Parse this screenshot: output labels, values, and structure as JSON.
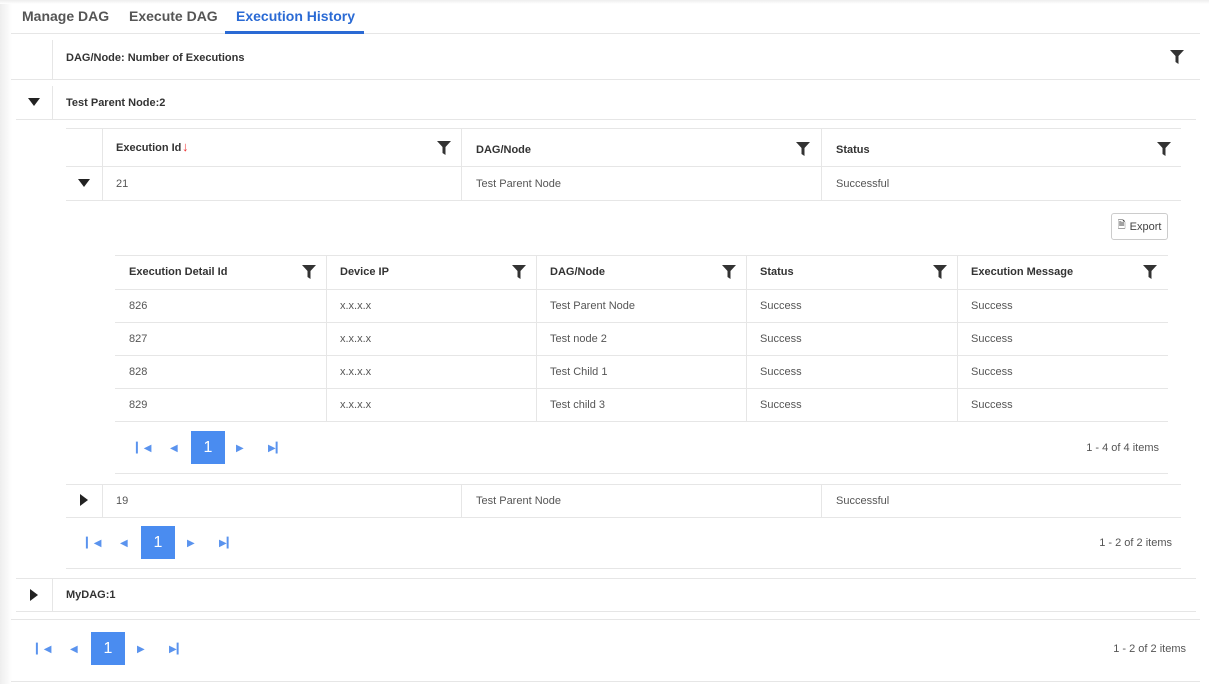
{
  "tabs": [
    {
      "label": "Manage DAG"
    },
    {
      "label": "Execute DAG"
    },
    {
      "label": "Execution History"
    }
  ],
  "outer": {
    "header": "DAG/Node: Number of Executions",
    "groups": [
      {
        "label": "Test Parent Node:2"
      },
      {
        "label": "MyDAG:1"
      }
    ],
    "pager": {
      "page": "1",
      "info": "1 - 2 of 2 items"
    }
  },
  "inner": {
    "columns": [
      "Execution Id",
      "DAG/Node",
      "Status"
    ],
    "rows": [
      {
        "id": "21",
        "node": "Test Parent Node",
        "status": "Successful"
      },
      {
        "id": "19",
        "node": "Test Parent Node",
        "status": "Successful"
      }
    ],
    "pager": {
      "page": "1",
      "info": "1 - 2 of 2 items"
    }
  },
  "detail": {
    "export_label": "Export",
    "columns": [
      "Execution Detail Id",
      "Device IP",
      "DAG/Node",
      "Status",
      "Execution Message"
    ],
    "rows": [
      [
        "826",
        "x.x.x.x",
        "Test Parent Node",
        "Success",
        "Success"
      ],
      [
        "827",
        "x.x.x.x",
        "Test node 2",
        "Success",
        "Success"
      ],
      [
        "828",
        "x.x.x.x",
        "Test Child 1",
        "Success",
        "Success"
      ],
      [
        "829",
        "x.x.x.x",
        "Test child 3",
        "Success",
        "Success"
      ]
    ],
    "pager": {
      "page": "1",
      "info": "1 - 4 of 4 items"
    }
  },
  "colors": {
    "accent": "#2a6ad4",
    "pager": "#4a8cf0",
    "sort": "#e33333"
  }
}
